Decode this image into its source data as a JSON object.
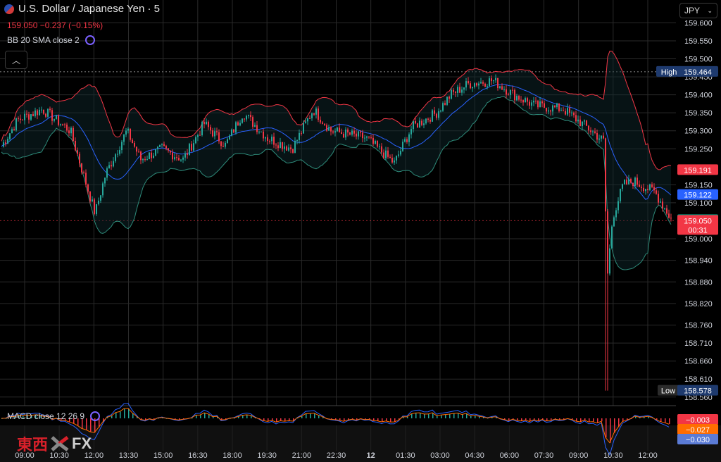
{
  "header": {
    "title": "U.S. Dollar / Japanese Yen · 5",
    "price": "159.050",
    "change": "−0.237 (−0.15%)",
    "bb_label": "BB 20 SMA close 2",
    "macd_label": "MACD close 12 26 9",
    "currency": "JPY",
    "collapse_icon": "chevron-up-icon"
  },
  "logo": {
    "text_jp": "東西",
    "text_fx": "FX"
  },
  "price_axis": {
    "ticks": [
      "159.600",
      "159.550",
      "159.500",
      "159.450",
      "159.400",
      "159.350",
      "159.300",
      "159.250",
      "159.150",
      "159.100",
      "159.000",
      "158.940",
      "158.880",
      "158.820",
      "158.760",
      "158.710",
      "158.660",
      "158.610",
      "158.560"
    ]
  },
  "time_axis": {
    "ticks": [
      "09:00",
      "10:30",
      "12:00",
      "13:30",
      "15:00",
      "16:30",
      "18:00",
      "19:30",
      "21:00",
      "22:30",
      "12",
      "01:30",
      "03:00",
      "04:30",
      "06:00",
      "07:30",
      "09:00",
      "10:30",
      "12:00"
    ]
  },
  "labels": {
    "high": {
      "text": "High",
      "value": "159.464"
    },
    "low": {
      "text": "Low",
      "value": "158.578"
    },
    "bb_upper": "159.191",
    "bb_mid": "159.122",
    "bb_lower": "159.052",
    "last_price": "159.050",
    "countdown": "00:31",
    "macd_hist": "−0.003",
    "macd_signal": "−0.027",
    "macd_line": "−0.030"
  },
  "colors": {
    "up": "#26a69a",
    "down": "#f23645",
    "bb_basis": "#2962ff",
    "bb_upper": "#f23645",
    "bb_lower": "#2e8b7a",
    "macd": "#2962ff",
    "signal": "#ff6d00"
  },
  "chart_data": {
    "type": "candlestick",
    "title": "U.S. Dollar / Japanese Yen · 5",
    "y_range": [
      158.54,
      159.64
    ],
    "high": 159.464,
    "low": 158.578,
    "last": 159.05,
    "bb": {
      "upper": 159.191,
      "basis": 159.122,
      "lower": 159.052
    },
    "macd": {
      "hist": -0.003,
      "signal": -0.027,
      "macd": -0.03
    }
  }
}
